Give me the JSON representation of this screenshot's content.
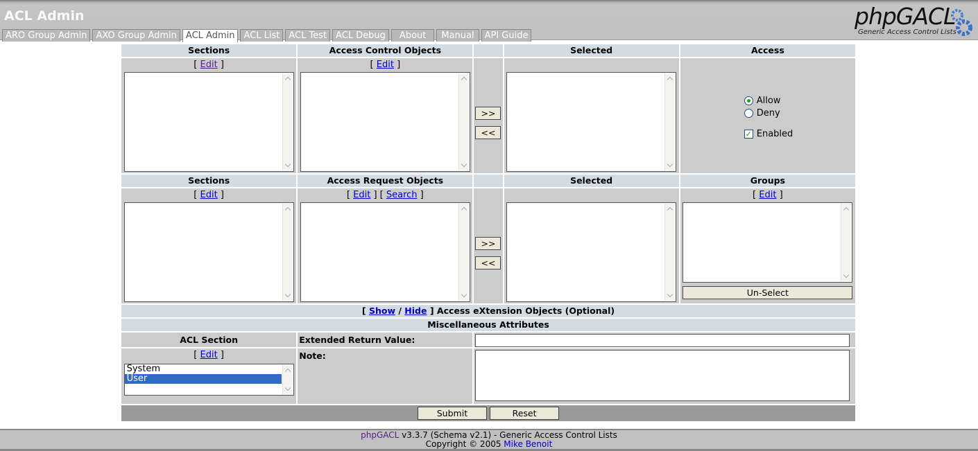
{
  "header": {
    "title": "ACL Admin",
    "logo_title": "phpGACL",
    "logo_subtitle": "Generic Access Control Lists"
  },
  "tabs": [
    "ARO Group Admin",
    "AXO Group Admin",
    "ACL Admin",
    "ACL List",
    "ACL Test",
    "ACL Debug",
    "About",
    "Manual",
    "API Guide"
  ],
  "active_tab": "ACL Admin",
  "aco": {
    "sections": "Sections",
    "objects": "Access Control Objects",
    "selected": "Selected",
    "access": "Access",
    "edit": "Edit",
    "add": ">>",
    "remove": "<<",
    "allow": "Allow",
    "deny": "Deny",
    "enabled": "Enabled",
    "access_value": "Allow",
    "enabled_checked": true
  },
  "aro": {
    "sections": "Sections",
    "objects": "Access Request Objects",
    "selected": "Selected",
    "groups": "Groups",
    "edit": "Edit",
    "search": "Search",
    "add": ">>",
    "remove": "<<",
    "unselect": "Un-Select"
  },
  "axo": {
    "show": "Show",
    "hide": "Hide",
    "label": "Access eXtension Objects (Optional)"
  },
  "misc": {
    "title": "Miscellaneous Attributes",
    "acl_section": "ACL Section",
    "edit": "Edit",
    "sections": [
      "System",
      "User"
    ],
    "selected_section": "User",
    "return_value_label": "Extended Return Value:",
    "return_value": "",
    "note_label": "Note:",
    "note": ""
  },
  "actions": {
    "submit": "Submit",
    "reset": "Reset"
  },
  "footer": {
    "product": "phpGACL",
    "version": " v3.3.7 (Schema v2.1) - Generic Access Control Lists",
    "copyright": "Copyright © 2005 ",
    "author": "Mike Benoit"
  }
}
